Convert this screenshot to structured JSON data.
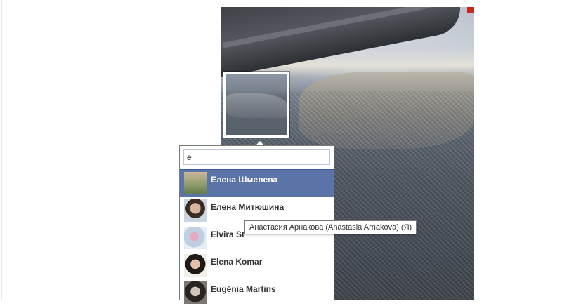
{
  "search": {
    "value": "е"
  },
  "results": [
    {
      "name": "Елена Шмелева",
      "selected": true
    },
    {
      "name": "Елена Митюшина",
      "selected": false
    },
    {
      "name": "Elvira St",
      "selected": false
    },
    {
      "name": "Elena Komar",
      "selected": false
    },
    {
      "name": "Eugénia Martins",
      "selected": false
    }
  ],
  "tooltip": {
    "text": "Анастасия Арнакова (Anastasia Arnakova) (Я)"
  },
  "colors": {
    "selected_bg": "#5b74a8",
    "tag_border": "#ffffff",
    "accent": "#3b5998"
  }
}
